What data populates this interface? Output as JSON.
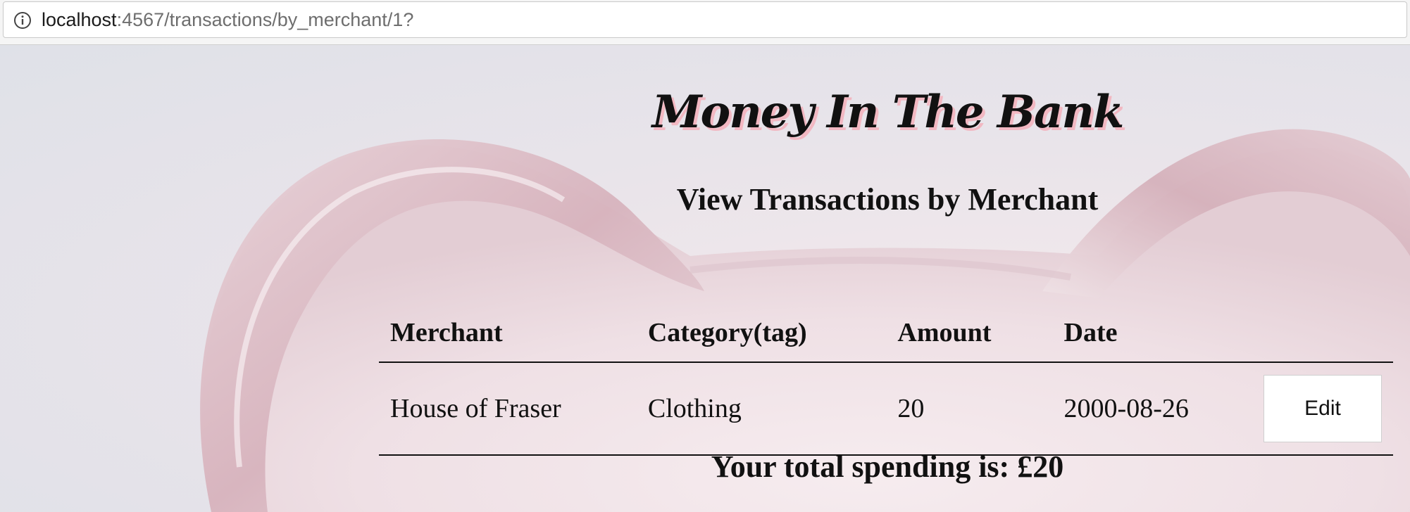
{
  "browser": {
    "url_host": "localhost",
    "url_rest": ":4567/transactions/by_merchant/1?"
  },
  "site": {
    "title": "Money In The Bank"
  },
  "page": {
    "heading": "View Transactions by Merchant",
    "total_text": "Your total spending is: £20"
  },
  "table": {
    "headers": [
      "Merchant",
      "Category(tag)",
      "Amount",
      "Date"
    ],
    "rows": [
      {
        "merchant": "House of Fraser",
        "category": "Clothing",
        "amount": "20",
        "date": "2000-08-26",
        "action_label": "Edit"
      }
    ]
  },
  "colors": {
    "title_shadow": "#f2b8c2",
    "piggy_pink": "#e8cdd4",
    "text": "#111111"
  }
}
